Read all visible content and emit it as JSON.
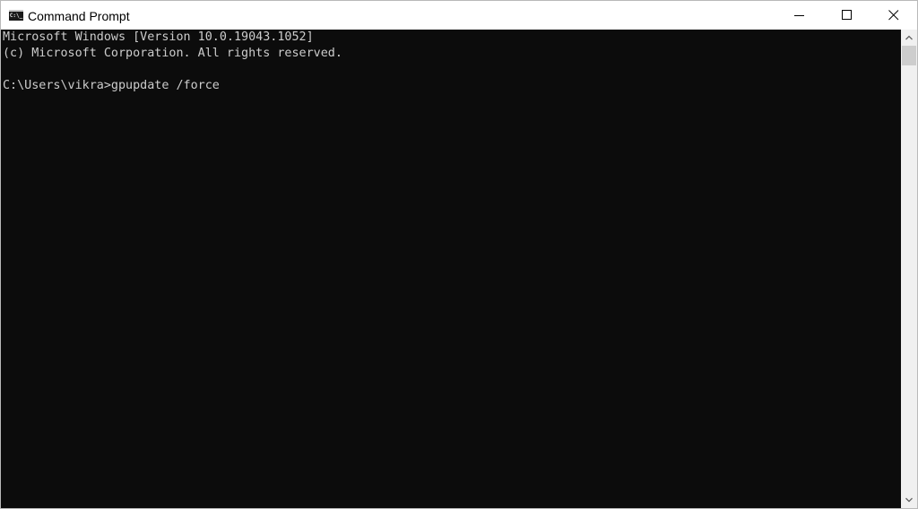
{
  "window": {
    "title": "Command Prompt",
    "icon": "cmd-icon",
    "icon_text": "C:\\_",
    "controls": {
      "minimize": "minimize-icon",
      "maximize": "maximize-icon",
      "close": "close-icon"
    }
  },
  "console": {
    "background": "#0c0c0c",
    "foreground": "#cccccc",
    "lines": [
      "Microsoft Windows [Version 10.0.19043.1052]",
      "(c) Microsoft Corporation. All rights reserved.",
      "",
      "C:\\Users\\vikra>gpupdate /force"
    ]
  },
  "scrollbar": {
    "up": "chevron-up-icon",
    "down": "chevron-down-icon",
    "position": 0
  }
}
